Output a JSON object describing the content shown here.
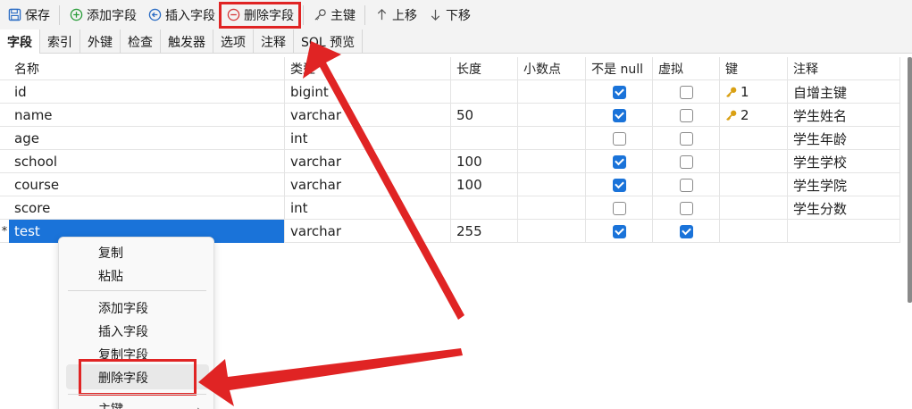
{
  "toolbar": {
    "save": "保存",
    "add_field": "添加字段",
    "insert_field": "插入字段",
    "delete_field": "删除字段",
    "primary_key": "主键",
    "move_up": "上移",
    "move_down": "下移"
  },
  "tabs": [
    "字段",
    "索引",
    "外键",
    "检查",
    "触发器",
    "选项",
    "注释",
    "SQL 预览"
  ],
  "columns": [
    "名称",
    "类型",
    "长度",
    "小数点",
    "不是 null",
    "虚拟",
    "键",
    "注释"
  ],
  "rows": [
    {
      "marker": "",
      "name": "id",
      "type": "bigint",
      "length": "",
      "not_null": true,
      "virtual": false,
      "key": "1",
      "comment": "自增主键"
    },
    {
      "marker": "",
      "name": "name",
      "type": "varchar",
      "length": "50",
      "not_null": true,
      "virtual": false,
      "key": "2",
      "comment": "学生姓名"
    },
    {
      "marker": "",
      "name": "age",
      "type": "int",
      "length": "",
      "not_null": false,
      "virtual": false,
      "key": "",
      "comment": "学生年龄"
    },
    {
      "marker": "",
      "name": "school",
      "type": "varchar",
      "length": "100",
      "not_null": true,
      "virtual": false,
      "key": "",
      "comment": "学生学校"
    },
    {
      "marker": "",
      "name": "course",
      "type": "varchar",
      "length": "100",
      "not_null": true,
      "virtual": false,
      "key": "",
      "comment": "学生学院"
    },
    {
      "marker": "",
      "name": "score",
      "type": "int",
      "length": "",
      "not_null": false,
      "virtual": false,
      "key": "",
      "comment": "学生分数"
    },
    {
      "marker": "*",
      "name": "test",
      "type": "varchar",
      "length": "255",
      "not_null": true,
      "virtual": true,
      "key": "",
      "comment": ""
    }
  ],
  "context_menu": {
    "copy": "复制",
    "paste": "粘贴",
    "add_field": "添加字段",
    "insert_field": "插入字段",
    "duplicate_field": "复制字段",
    "delete_field": "删除字段",
    "primary_key": "主键"
  },
  "colors": {
    "accent": "#1a73d9",
    "annotation_red": "#e02424",
    "key_gold": "#d9a013"
  }
}
